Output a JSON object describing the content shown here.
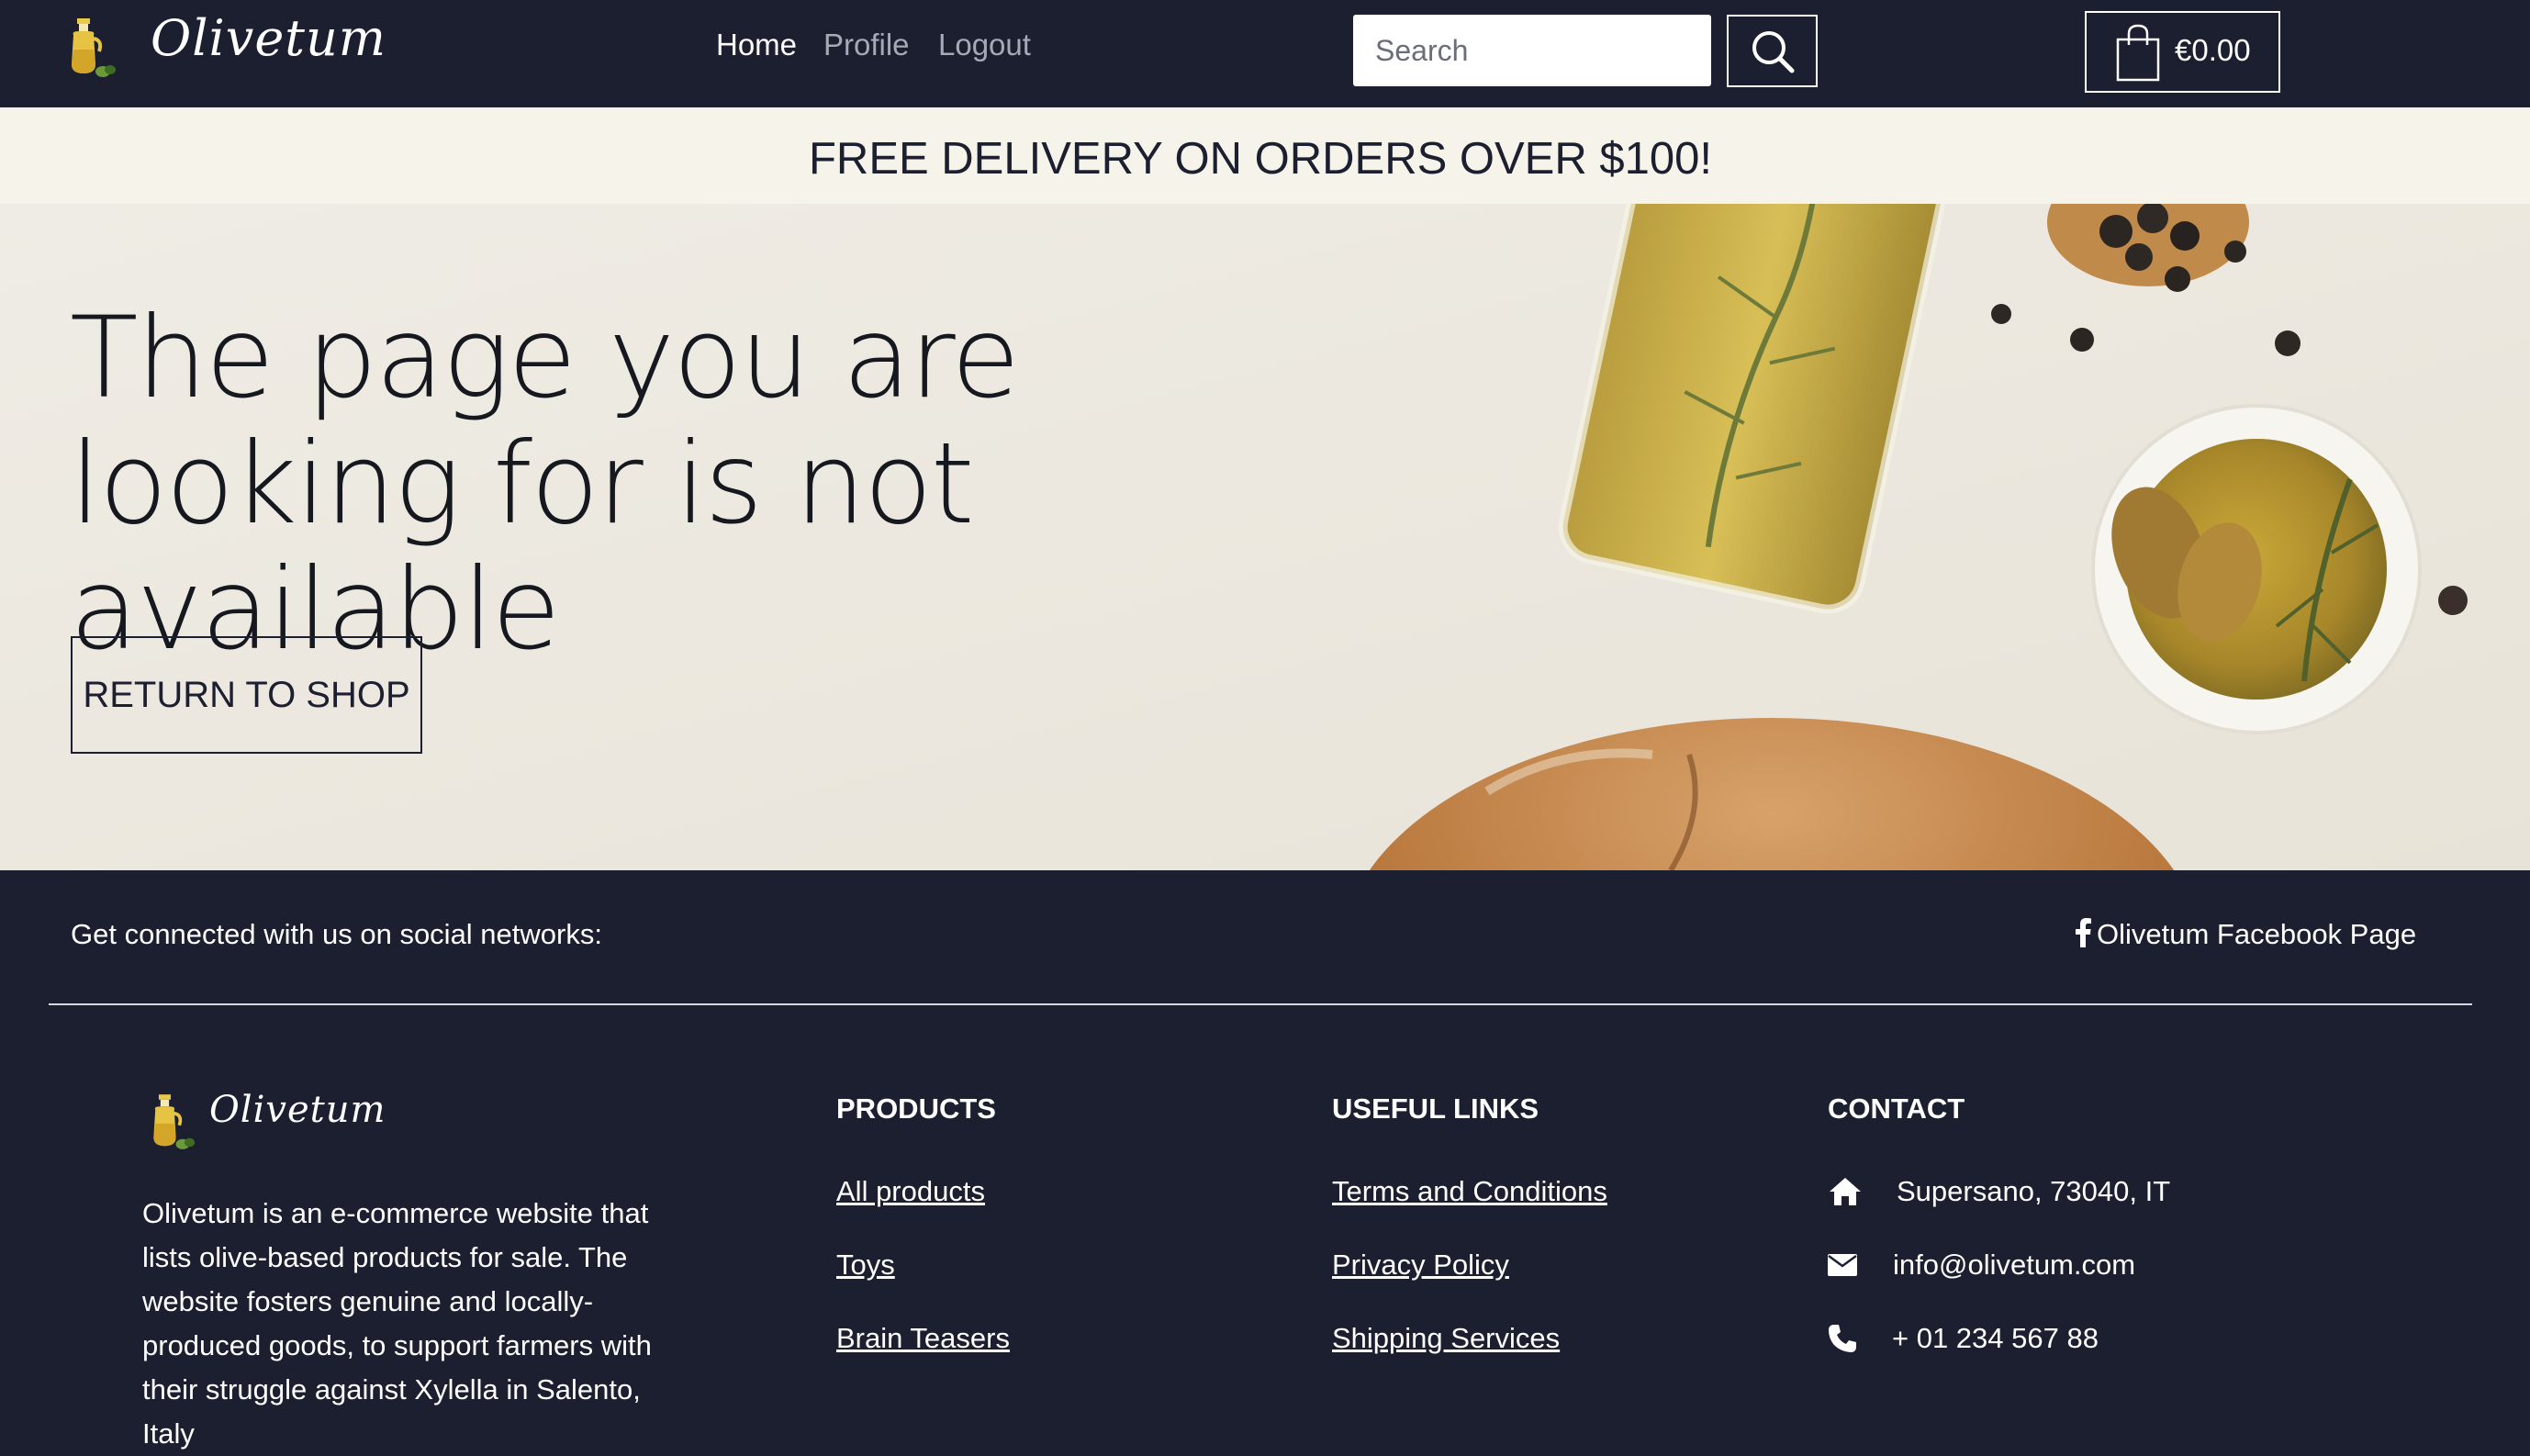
{
  "brand": {
    "name": "Olivetum"
  },
  "nav": {
    "links": [
      {
        "label": "Home",
        "active": true
      },
      {
        "label": "Profile",
        "active": false
      },
      {
        "label": "Logout",
        "active": false
      }
    ]
  },
  "search": {
    "placeholder": "Search",
    "value": ""
  },
  "cart": {
    "total": "€0.00"
  },
  "banner": {
    "text": "FREE DELIVERY ON ORDERS OVER $100!"
  },
  "hero": {
    "heading": "The page you are looking for is not available",
    "button_label": "RETURN TO SHOP"
  },
  "footer": {
    "social_text": "Get connected with us on social networks:",
    "facebook_label": "Olivetum Facebook Page",
    "about": "Olivetum is an e-commerce website that lists olive-based products for sale. The website fosters genuine and locally-produced goods, to support farmers with their struggle against Xylella in Salento, Italy",
    "products": {
      "heading": "PRODUCTS",
      "links": [
        "All products",
        "Toys",
        "Brain Teasers"
      ]
    },
    "useful_links": {
      "heading": "USEFUL LINKS",
      "links": [
        "Terms and Conditions",
        "Privacy Policy",
        "Shipping Services"
      ]
    },
    "contact": {
      "heading": "CONTACT",
      "address": "Supersano, 73040, IT",
      "email": "info@olivetum.com",
      "phone": "+ 01 234 567 88"
    }
  },
  "icons": {
    "logo": "olive-oil-jar-icon",
    "search": "search-icon",
    "cart": "shopping-bag-icon",
    "facebook": "facebook-icon",
    "home": "home-icon",
    "email": "envelope-icon",
    "phone": "phone-icon"
  },
  "colors": {
    "navy": "#1b1f30",
    "banner_bg": "#f6f3ea",
    "hero_bg": "#ede9e1",
    "white": "#ffffff",
    "nav_muted": "#a6a9b6"
  }
}
